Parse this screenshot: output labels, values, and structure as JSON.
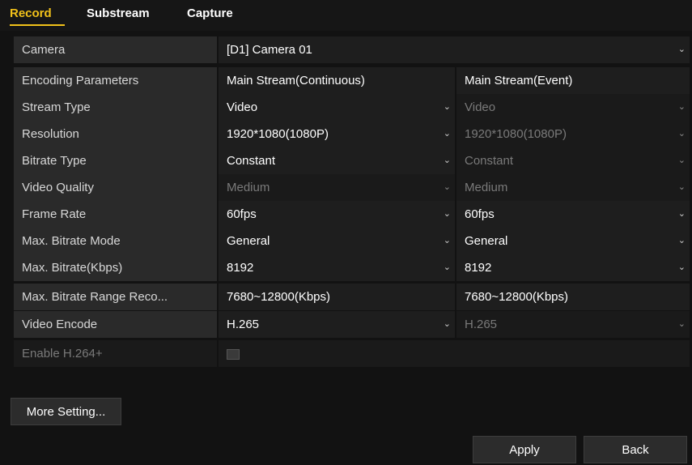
{
  "tabs": [
    "Record",
    "Substream",
    "Capture"
  ],
  "camera": {
    "label": "Camera",
    "value": "[D1] Camera 01"
  },
  "header": {
    "label": "Encoding Parameters",
    "col1": "Main Stream(Continuous)",
    "col2": "Main Stream(Event)"
  },
  "rows": [
    {
      "label": "Stream Type",
      "col1": "Video",
      "col2": "Video"
    },
    {
      "label": "Resolution",
      "col1": "1920*1080(1080P)",
      "col2": "1920*1080(1080P)"
    },
    {
      "label": "Bitrate Type",
      "col1": "Constant",
      "col2": "Constant"
    },
    {
      "label": "Video Quality",
      "col1": "Medium",
      "col2": "Medium"
    },
    {
      "label": "Frame Rate",
      "col1": "60fps",
      "col2": "60fps"
    },
    {
      "label": "Max. Bitrate Mode",
      "col1": "General",
      "col2": "General"
    },
    {
      "label": "Max. Bitrate(Kbps)",
      "col1": "8192",
      "col2": "8192"
    },
    {
      "label": "Max. Bitrate Range Reco...",
      "col1": "7680~12800(Kbps)",
      "col2": "7680~12800(Kbps)"
    },
    {
      "label": "Video Encode",
      "col1": "H.265",
      "col2": "H.265"
    }
  ],
  "enable_h264plus": {
    "label": "Enable H.264+",
    "checked": false
  },
  "buttons": {
    "more": "More Setting...",
    "apply": "Apply",
    "back": "Back"
  },
  "icons": {
    "dropdown": "chevron-down-icon",
    "checkbox": "checkbox-icon"
  },
  "colors": {
    "accent": "#f2c21a",
    "background": "#121212",
    "label_bg": "#2a2a2a",
    "field_bg": "#1e1e1e",
    "disabled_text": "#7a7a7a"
  }
}
